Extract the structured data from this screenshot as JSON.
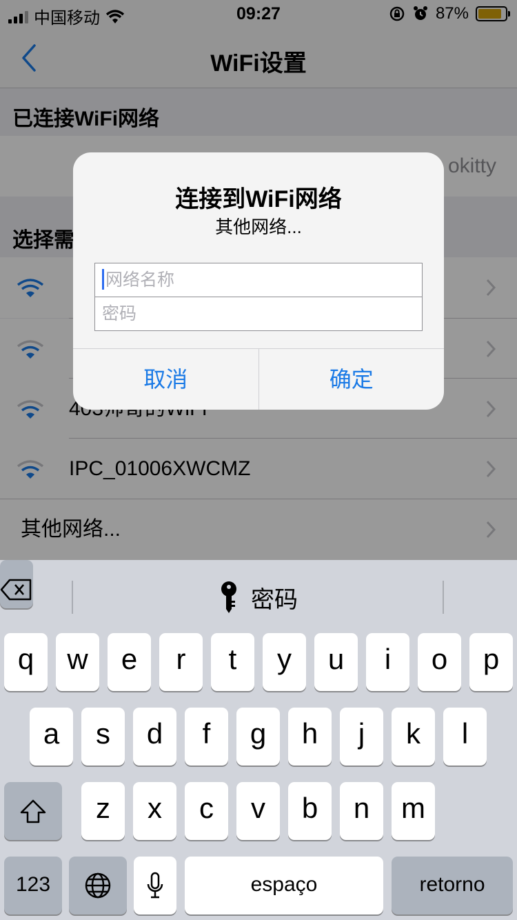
{
  "status_bar": {
    "carrier": "中国移动",
    "time": "09:27",
    "battery": "87%",
    "battery_level": 0.87
  },
  "nav": {
    "title": "WiFi设置"
  },
  "connected_section": {
    "header": "已连接WiFi网络",
    "network_name": "okitty"
  },
  "select_section": {
    "header": "选择需"
  },
  "networks": [
    {
      "label": ""
    },
    {
      "label": ""
    },
    {
      "label": "403帅哥的WiFi"
    },
    {
      "label": "IPC_01006XWCMZ"
    }
  ],
  "other_network": {
    "label": "其他网络..."
  },
  "alert": {
    "title": "连接到WiFi网络",
    "message": "其他网络...",
    "ssid_placeholder": "网络名称",
    "password_placeholder": "密码",
    "cancel_label": "取消",
    "ok_label": "确定"
  },
  "keyboard": {
    "suggestion": "密码",
    "row1": [
      "q",
      "w",
      "e",
      "r",
      "t",
      "y",
      "u",
      "i",
      "o",
      "p"
    ],
    "row2": [
      "a",
      "s",
      "d",
      "f",
      "g",
      "h",
      "j",
      "k",
      "l"
    ],
    "row3": [
      "z",
      "x",
      "c",
      "v",
      "b",
      "n",
      "m"
    ],
    "numbers_label": "123",
    "space_label": "espaço",
    "return_label": "retorno"
  }
}
